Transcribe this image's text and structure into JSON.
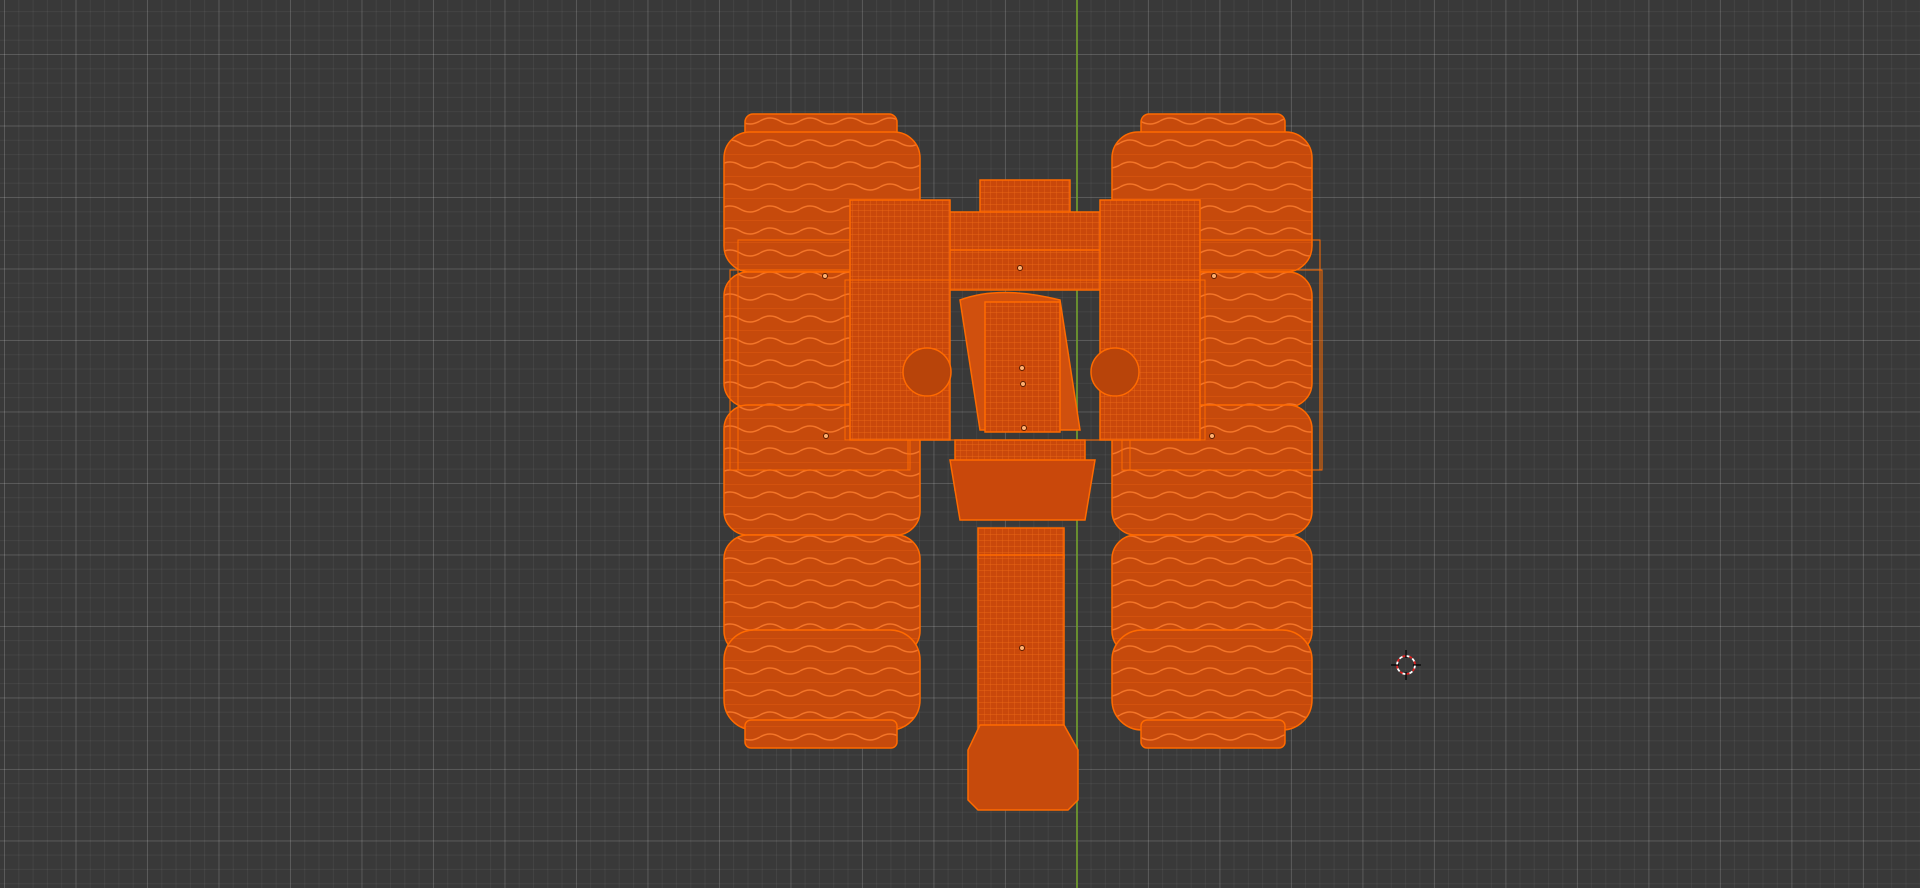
{
  "viewport": {
    "mode": "wireframe",
    "view": "top-orthographic",
    "background_color": "#393939",
    "grid_color": "#555555",
    "y_axis_color": "#6f9a2a"
  },
  "selection": {
    "object": "rover-model",
    "state": "selected",
    "wire_color": "#ff6a00",
    "fill_color": "#c2470b"
  },
  "cursor_3d": {
    "icon": "3d-cursor-icon",
    "ring_color": "#ffffff",
    "accent_color": "#e02020"
  }
}
